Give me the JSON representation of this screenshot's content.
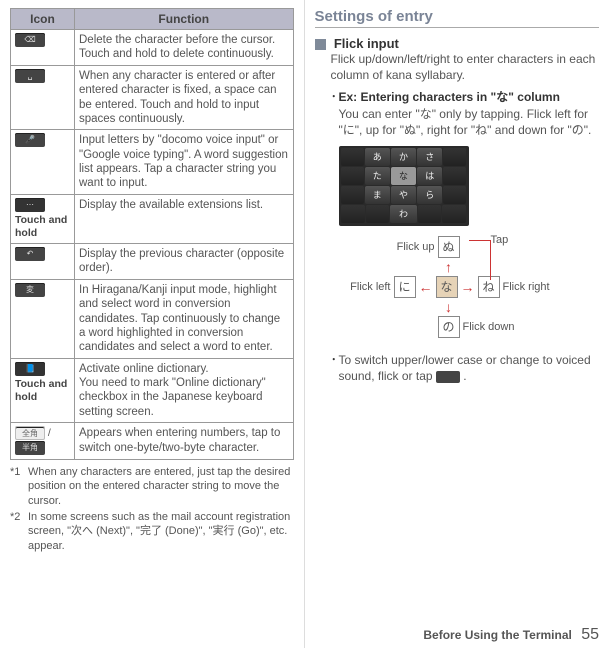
{
  "table": {
    "head_icon": "Icon",
    "head_func": "Function",
    "rows": [
      {
        "icon_aux": "",
        "func": "Delete the character before the cursor. Touch and hold to delete continuously."
      },
      {
        "icon_aux": "",
        "func": "When any character is entered or after entered character is fixed, a space can be entered. Touch and hold to input spaces continuously."
      },
      {
        "icon_aux": "",
        "func": "Input letters by \"docomo voice input\" or \"Google voice typing\". A word suggestion list appears. Tap a character string you want to input."
      },
      {
        "icon_aux": "Touch and hold",
        "func": "Display the available extensions list."
      },
      {
        "icon_aux": "",
        "func": "Display the previous character (opposite order)."
      },
      {
        "icon_aux": "",
        "func": "In Hiragana/Kanji input mode, highlight and select word in conversion candidates. Tap continuously to change a word highlighted in conversion candidates and select a word to enter."
      },
      {
        "icon_aux": "Touch and hold",
        "func": "Activate online dictionary.\nYou need to mark \"Online dictionary\" checkbox in the Japanese keyboard setting screen."
      },
      {
        "icon_aux": "",
        "func": "Appears when entering numbers, tap to switch one-byte/two-byte character."
      }
    ]
  },
  "footnotes": {
    "n1_mark": "*1",
    "n1": "When any characters are entered, just tap the desired position on the entered character string to move the cursor.",
    "n2_mark": "*2",
    "n2": "In some screens such as the mail account registration screen, \"次へ (Next)\", \"完了 (Done)\", \"実行 (Go)\", etc. appear."
  },
  "right": {
    "title": "Settings of entry",
    "sub": "Flick input",
    "desc": "Flick up/down/left/right to enter characters in each column of kana syllabary.",
    "ex_title": "Ex: Entering characters in \"な\" column",
    "ex_body": "You can enter \"な\" only by tapping. Flick left for \"に\", up for \"ぬ\", right for \"ね\" and down for \"の\".",
    "flick": {
      "up_label": "Flick up",
      "tap_label": "Tap",
      "left_label": "Flick left",
      "right_label": "Flick right",
      "down_label": "Flick down",
      "up_char": "ぬ",
      "left_char": "に",
      "center_char": "な",
      "right_char": "ね",
      "down_char": "の"
    },
    "bullet2": "To switch upper/lower case or change to voiced sound, flick or tap "
  },
  "kbd": {
    "row0": [
      "",
      "あ",
      "か",
      "さ",
      ""
    ],
    "row1": [
      "",
      "た",
      "な",
      "は",
      ""
    ],
    "row2": [
      "",
      "ま",
      "や",
      "ら",
      ""
    ],
    "row3": [
      "",
      "",
      "わ",
      "",
      ""
    ]
  },
  "footer": {
    "section": "Before Using the Terminal",
    "page": "55"
  }
}
